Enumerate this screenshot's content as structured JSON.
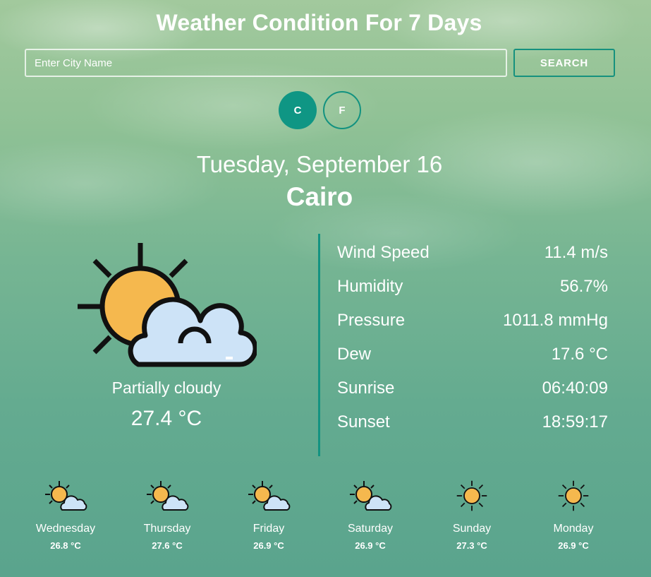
{
  "header": {
    "title": "Weather Condition For 7 Days"
  },
  "search": {
    "placeholder": "Enter City Name",
    "button_label": "SEARCH"
  },
  "units": {
    "celsius_label": "C",
    "fahrenheit_label": "F",
    "selected": "C"
  },
  "current": {
    "date": "Tuesday, September 16",
    "city": "Cairo",
    "icon": "partly-cloudy-icon",
    "condition": "Partially cloudy",
    "temperature": "27.4 °C"
  },
  "details": [
    {
      "label": "Wind Speed",
      "value": "11.4 m/s"
    },
    {
      "label": "Humidity",
      "value": "56.7%"
    },
    {
      "label": "Pressure",
      "value": "1011.8 mmHg"
    },
    {
      "label": "Dew",
      "value": "17.6 °C"
    },
    {
      "label": "Sunrise",
      "value": "06:40:09"
    },
    {
      "label": "Sunset",
      "value": "18:59:17"
    }
  ],
  "forecast": [
    {
      "day": "Wednesday",
      "temp": "26.8 °C",
      "icon": "partly-cloudy-icon"
    },
    {
      "day": "Thursday",
      "temp": "27.6 °C",
      "icon": "partly-cloudy-icon"
    },
    {
      "day": "Friday",
      "temp": "26.9 °C",
      "icon": "partly-cloudy-icon"
    },
    {
      "day": "Saturday",
      "temp": "26.9 °C",
      "icon": "partly-cloudy-icon"
    },
    {
      "day": "Sunday",
      "temp": "27.3 °C",
      "icon": "sun-icon"
    },
    {
      "day": "Monday",
      "temp": "26.9 °C",
      "icon": "sun-icon"
    }
  ],
  "colors": {
    "accent": "#0f9684",
    "sun": "#f5b84e",
    "cloud": "#cde3f7",
    "outline": "#111111"
  }
}
